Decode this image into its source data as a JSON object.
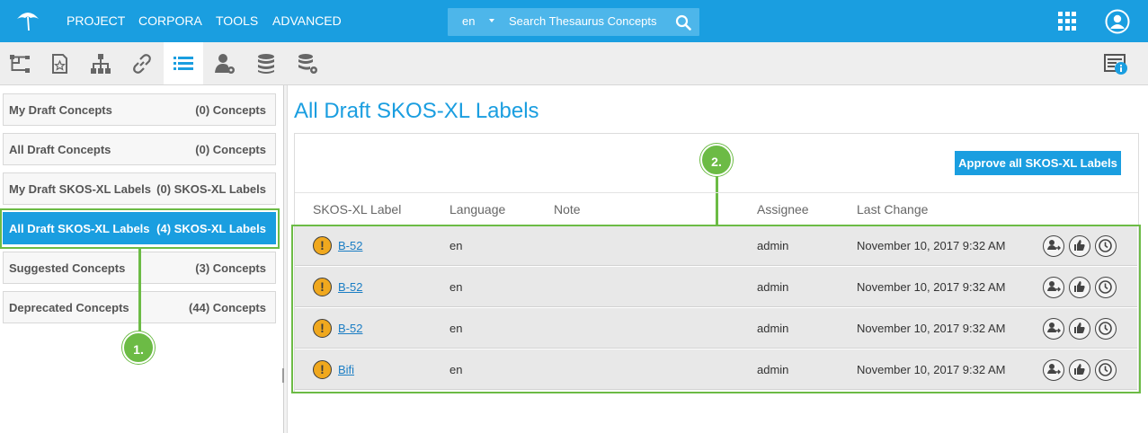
{
  "topbar": {
    "menu": [
      "PROJECT",
      "CORPORA",
      "TOOLS",
      "ADVANCED"
    ],
    "search": {
      "language": "en",
      "placeholder": "Search Thesaurus Concepts"
    },
    "icons": [
      "umbrella-logo-icon",
      "search-icon",
      "apps-grid-icon",
      "user-account-icon"
    ]
  },
  "toolbar": {
    "icons": [
      "hierarchy-branch-icon",
      "concept-document-icon",
      "org-tree-icon",
      "link-icon",
      "list-icon",
      "user-settings-icon",
      "database-icon",
      "server-settings-icon",
      "info-panel-icon"
    ],
    "active": "list-icon"
  },
  "sidebar": {
    "items": [
      {
        "label": "My Draft Concepts",
        "count": "(0) Concepts"
      },
      {
        "label": "All Draft Concepts",
        "count": "(0) Concepts"
      },
      {
        "label": "My Draft SKOS-XL Labels",
        "count": "(0) SKOS-XL Labels"
      },
      {
        "label": "All Draft SKOS-XL Labels",
        "count": "(4) SKOS-XL Labels",
        "active": true
      },
      {
        "label": "Suggested Concepts",
        "count": "(3) Concepts"
      },
      {
        "label": "Deprecated Concepts",
        "count": "(44) Concepts"
      }
    ]
  },
  "annotations": {
    "one": "1.",
    "two": "2."
  },
  "main": {
    "title": "All Draft SKOS-XL Labels",
    "approve_button": "Approve all SKOS-XL Labels",
    "columns": [
      "SKOS-XL Label",
      "Language",
      "Note",
      "Assignee",
      "Last Change"
    ],
    "rows": [
      {
        "label": "B-52",
        "language": "en",
        "note": "",
        "assignee": "admin",
        "last_change": "November 10, 2017 9:32 AM"
      },
      {
        "label": "B-52",
        "language": "en",
        "note": "",
        "assignee": "admin",
        "last_change": "November 10, 2017 9:32 AM"
      },
      {
        "label": "B-52",
        "language": "en",
        "note": "",
        "assignee": "admin",
        "last_change": "November 10, 2017 9:32 AM"
      },
      {
        "label": "Bifi",
        "language": "en",
        "note": "",
        "assignee": "admin",
        "last_change": "November 10, 2017 9:32 AM"
      }
    ],
    "status_icon": "!",
    "row_actions": [
      "assign-user-icon",
      "approve-thumbs-up-icon",
      "history-clock-icon"
    ]
  },
  "colors": {
    "brand": "#1a9ee0",
    "highlight": "#6cbb45",
    "warning": "#f0a81e",
    "row_bg": "#e8e8e8"
  }
}
